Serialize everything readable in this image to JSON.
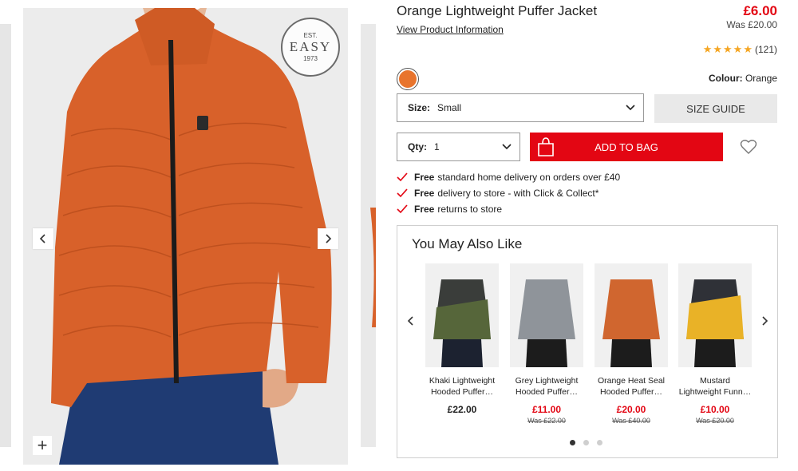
{
  "gallery": {
    "brand_badge": {
      "top": "EST.",
      "word": "EASY",
      "year": "1973"
    },
    "zoom_label": "+",
    "product_color": "#d8612a",
    "jeans_color": "#1f3b73"
  },
  "product": {
    "title": "Orange Lightweight Puffer Jacket",
    "info_link": "View Product Information",
    "price": "£6.00",
    "was_price": "Was £20.00",
    "rating_stars": 5,
    "rating_count": "(121)",
    "colour_label": "Colour:",
    "colour_value": "Orange",
    "swatch_color": "#e8742d"
  },
  "size_select": {
    "label": "Size:",
    "value": "Small"
  },
  "size_guide": "SIZE GUIDE",
  "qty_select": {
    "label": "Qty:",
    "value": "1"
  },
  "add_to_bag": "ADD TO BAG",
  "delivery": [
    {
      "bold": "Free",
      "text": "standard home delivery on orders over £40"
    },
    {
      "bold": "Free",
      "text": "delivery to store - with Click & Collect*"
    },
    {
      "bold": "Free",
      "text": "returns to store"
    }
  ],
  "recommendations": {
    "title": "You May Also Like",
    "items": [
      {
        "name1": "Khaki Lightweight",
        "name2": "Hooded Puffer…",
        "price": "£22.00",
        "was": "",
        "sale": false,
        "top": "#3a3d3a",
        "bottom": "#56663a"
      },
      {
        "name1": "Grey Lightweight",
        "name2": "Hooded Puffer…",
        "price": "£11.00",
        "was": "Was £22.00",
        "sale": true,
        "top": "#8f949a",
        "bottom": "#8f949a"
      },
      {
        "name1": "Orange Heat Seal",
        "name2": "Hooded Puffer…",
        "price": "£20.00",
        "was": "Was £40.00",
        "sale": true,
        "top": "#d0662f",
        "bottom": "#d0662f"
      },
      {
        "name1": "Mustard",
        "name2": "Lightweight Funn…",
        "price": "£10.00",
        "was": "Was £20.00",
        "sale": true,
        "top": "#2f3137",
        "bottom": "#e9b227"
      }
    ],
    "page_count": 3,
    "active_page": 1
  },
  "colors": {
    "accent_red": "#e30613",
    "star": "#f5a623"
  }
}
